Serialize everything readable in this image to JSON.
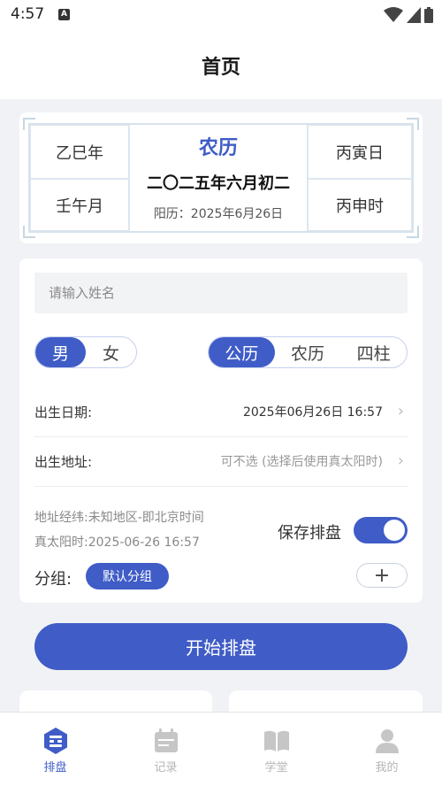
{
  "status_bar": {
    "time": "4:57",
    "notification_icon": "A"
  },
  "header": {
    "title": "首页"
  },
  "calendar": {
    "year_ganzhi": "乙巳年",
    "month_ganzhi": "壬午月",
    "lunar_title": "农历",
    "lunar_date": "二〇二五年六月初二",
    "solar_date": "阳历：2025年6月26日",
    "day_ganzhi": "丙寅日",
    "hour_ganzhi": "丙申时"
  },
  "form": {
    "name_placeholder": "请输入姓名",
    "gender": {
      "options": [
        "男",
        "女"
      ],
      "selected": "男"
    },
    "calendar_type": {
      "options": [
        "公历",
        "农历",
        "四柱"
      ],
      "selected": "公历"
    },
    "birth_date": {
      "label": "出生日期:",
      "value": "2025年06月26日 16:57"
    },
    "birth_place": {
      "label": "出生地址:",
      "value": "可不选 (选择后使用真太阳时)"
    },
    "location_info": "地址经纬:未知地区-即北京时间",
    "true_solar_time": "真太阳时:2025-06-26 16:57",
    "save_label": "保存排盘",
    "save_enabled": true,
    "group_label": "分组:",
    "group_value": "默认分组",
    "add_group_symbol": "+"
  },
  "start_button": "开始排盘",
  "tabs": [
    {
      "label": "排盘",
      "icon": "paipan-icon",
      "active": true
    },
    {
      "label": "记录",
      "icon": "calendar-icon",
      "active": false
    },
    {
      "label": "学堂",
      "icon": "book-icon",
      "active": false
    },
    {
      "label": "我的",
      "icon": "user-icon",
      "active": false
    }
  ],
  "colors": {
    "accent": "#3f5cc7",
    "background": "#f1f2f5",
    "inactive_tab": "#b5b5b5"
  }
}
